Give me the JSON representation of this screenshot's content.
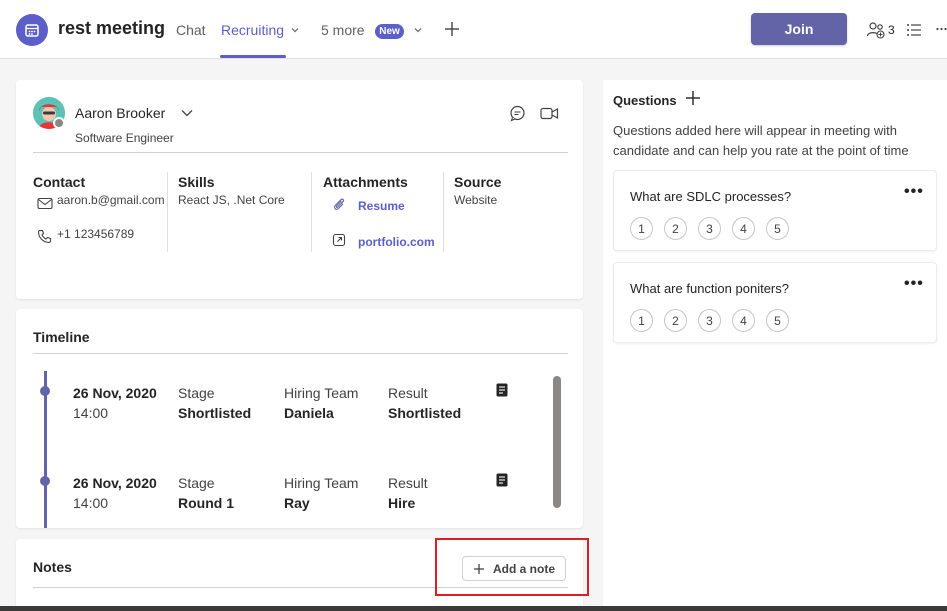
{
  "header": {
    "title": "rest meeting",
    "tabs": [
      {
        "label": "Chat"
      },
      {
        "label": "Recruiting"
      }
    ],
    "more_label": "5 more",
    "new_badge": "New",
    "join_label": "Join",
    "participants_count": "3"
  },
  "profile": {
    "name": "Aaron Brooker",
    "role": "Software Engineer",
    "contact": {
      "title": "Contact",
      "email": "aaron.b@gmail.com",
      "phone": "+1 123456789"
    },
    "skills": {
      "title": "Skills",
      "value": "React JS, .Net Core"
    },
    "attachments": {
      "title": "Attachments",
      "items": [
        "Resume",
        "portfolio.com"
      ]
    },
    "source": {
      "title": "Source",
      "value": "Website"
    }
  },
  "timeline": {
    "title": "Timeline",
    "entries": [
      {
        "date": "26 Nov, 2020",
        "time": "14:00",
        "stage_label": "Stage",
        "stage": "Shortlisted",
        "team_label": "Hiring Team",
        "team": "Daniela",
        "result_label": "Result",
        "result": "Shortlisted"
      },
      {
        "date": "26 Nov, 2020",
        "time": "14:00",
        "stage_label": "Stage",
        "stage": "Round 1",
        "team_label": "Hiring Team",
        "team": "Ray",
        "result_label": "Result",
        "result": "Hire"
      }
    ]
  },
  "notes": {
    "title": "Notes",
    "add_label": "Add a note"
  },
  "questions": {
    "title": "Questions",
    "description": "Questions added here will appear in meeting with candidate and can help you rate at the point of time",
    "items": [
      {
        "text": "What are SDLC processes?",
        "ratings": [
          "1",
          "2",
          "3",
          "4",
          "5"
        ]
      },
      {
        "text": "What are function poniters?",
        "ratings": [
          "1",
          "2",
          "3",
          "4",
          "5"
        ]
      }
    ],
    "more_label": "•••"
  },
  "colors": {
    "brand": "#5b5fc7",
    "join": "#6264a7",
    "highlight": "#d92027"
  }
}
